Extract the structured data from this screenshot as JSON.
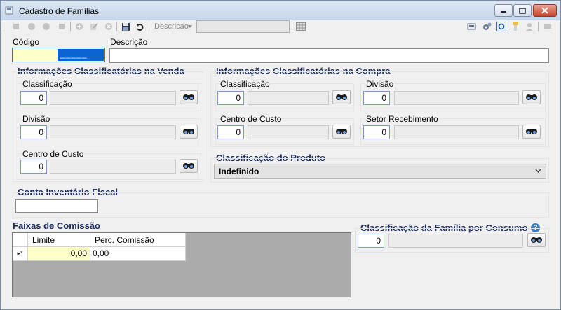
{
  "window": {
    "title": "Cadastro de Famílias"
  },
  "toolbar": {
    "search_label": "Descricao",
    "search_value": ""
  },
  "header": {
    "codigo_label": "Código",
    "codigo_value": "_____",
    "descricao_label": "Descrição",
    "descricao_value": ""
  },
  "venda": {
    "title": "Informações Classificatórias na Venda",
    "classificacao": {
      "label": "Classificação",
      "value": "0"
    },
    "divisao": {
      "label": "Divisão",
      "value": "0"
    },
    "centro_custo": {
      "label": "Centro de Custo",
      "value": "0"
    }
  },
  "compra": {
    "title": "Informações Classificatórias na Compra",
    "classificacao": {
      "label": "Classificação",
      "value": "0"
    },
    "divisao": {
      "label": "Divisão",
      "value": "0"
    },
    "centro_custo": {
      "label": "Centro de Custo",
      "value": "0"
    },
    "setor_recebimento": {
      "label": "Setor Recebimento",
      "value": "0"
    }
  },
  "produto": {
    "title": "Classificação do Produto",
    "selected": "Indefinido"
  },
  "inventario": {
    "title": "Conta Inventário Fiscal",
    "value": ""
  },
  "comissao": {
    "title": "Faixas de Comissão",
    "columns": [
      "Limite",
      "Perc. Comissão"
    ],
    "row_marker": "▸*",
    "new_row": [
      "0,00",
      "0,00"
    ]
  },
  "consumo": {
    "title": "Classificação da Família por Consumo",
    "value": "0"
  },
  "colors": {
    "group_title": "#1a2a5a",
    "field_border": "#7a9cc8",
    "codigo_bg": "#ffffc8"
  }
}
